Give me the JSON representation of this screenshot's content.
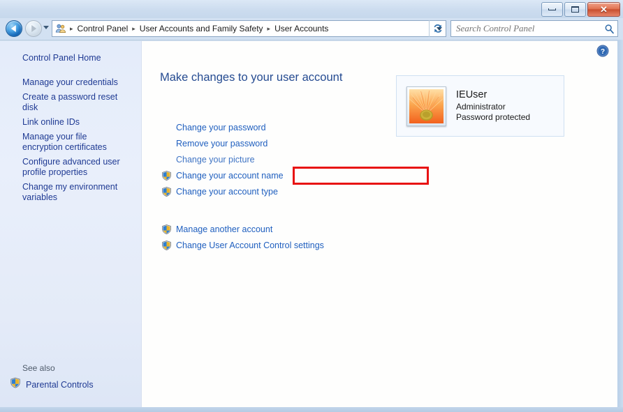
{
  "window": {
    "buttons": {
      "minimize": "minimize-button",
      "maximize": "maximize-button",
      "close": "✕"
    }
  },
  "navbar": {
    "back_tooltip": "Back",
    "forward_tooltip": "Forward",
    "breadcrumb": [
      "Control Panel",
      "User Accounts and Family Safety",
      "User Accounts"
    ],
    "separator": "▸",
    "refresh_icon": "refresh-icon",
    "search": {
      "placeholder": "Search Control Panel",
      "value": "",
      "icon": "search-icon"
    }
  },
  "sidebar": {
    "home_label": "Control Panel Home",
    "items": [
      {
        "label": "Manage your credentials"
      },
      {
        "label": "Create a password reset disk"
      },
      {
        "label": "Link online IDs"
      },
      {
        "label": "Manage your file encryption certificates"
      },
      {
        "label": "Configure advanced user profile properties"
      },
      {
        "label": "Change my environment variables"
      }
    ],
    "see_also_label": "See also",
    "see_also_items": [
      {
        "label": "Parental Controls",
        "icon": "shield-icon"
      }
    ]
  },
  "content": {
    "title": "Make changes to your user account",
    "tasks_group_1": [
      {
        "label": "Change your password",
        "icon": "",
        "highlighted": false
      },
      {
        "label": "Remove your password",
        "icon": "",
        "highlighted": false
      },
      {
        "label": "Change your picture",
        "icon": "",
        "highlighted": false
      },
      {
        "label": "Change your account name",
        "icon": "shield-icon",
        "highlighted": true
      },
      {
        "label": "Change your account type",
        "icon": "shield-icon",
        "highlighted": false
      }
    ],
    "tasks_group_2": [
      {
        "label": "Manage another account",
        "icon": "shield-icon",
        "highlighted": false
      },
      {
        "label": "Change User Account Control settings",
        "icon": "shield-icon",
        "highlighted": false
      }
    ],
    "user_card": {
      "name": "IEUser",
      "role": "Administrator",
      "password_state": "Password protected",
      "avatar_icon": "flower-avatar"
    },
    "help_icon": "help-icon"
  },
  "colors": {
    "link": "#1f5fbf",
    "sidebar_link": "#1f3a93",
    "title": "#254b91",
    "highlight": "#e81313",
    "chrome": "#cedef0"
  }
}
